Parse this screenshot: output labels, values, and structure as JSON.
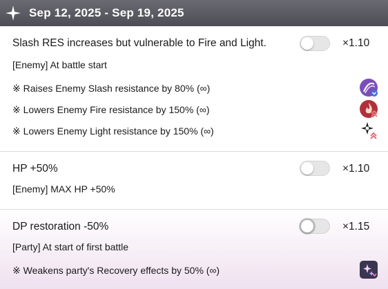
{
  "header": {
    "title": "Sep 12, 2025 - Sep 19, 2025"
  },
  "effects": [
    {
      "title": "Slash RES increases but vulnerable to Fire and Light.",
      "multiplier": "×1.10",
      "condition": "[Enemy] At battle start",
      "toggle_on": false,
      "details": [
        {
          "text": "※ Raises Enemy Slash resistance by 80% (∞)",
          "icon": "slash-resist-up-icon"
        },
        {
          "text": "※ Lowers Enemy Fire resistance by 150% (∞)",
          "icon": "fire-resist-down-icon"
        },
        {
          "text": "※ Lowers Enemy Light resistance by 150% (∞)",
          "icon": "light-resist-down-icon"
        }
      ]
    },
    {
      "title": "HP +50%",
      "multiplier": "×1.10",
      "condition": "[Enemy] MAX HP +50%",
      "toggle_on": false,
      "details": []
    },
    {
      "title": "DP restoration -50%",
      "multiplier": "×1.15",
      "condition": "[Party] At start of first battle",
      "toggle_on": false,
      "details": [
        {
          "text": "※ Weakens party's Recovery effects by 50% (∞)",
          "icon": "recovery-down-icon"
        }
      ]
    }
  ],
  "colors": {
    "header_bg": "#55555d",
    "slash_icon": "#7a4fb8",
    "fire_icon": "#b0303a",
    "recovery_icon": "#3a3550"
  }
}
